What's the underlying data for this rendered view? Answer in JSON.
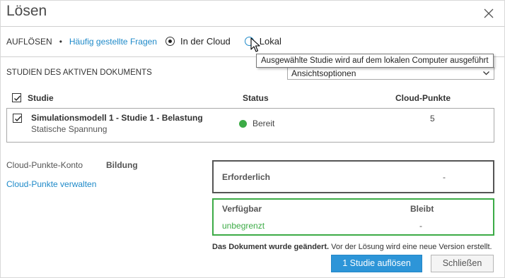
{
  "dialog": {
    "title": "Lösen"
  },
  "topbar": {
    "solve_label": "AUFLÖSEN",
    "separator": "•",
    "faq_link": "Häufig gestellte Fragen",
    "options": [
      {
        "label": "In der Cloud",
        "selected": true
      },
      {
        "label": "Lokal",
        "selected": false
      }
    ],
    "tooltip": "Ausgewählte Studie wird auf dem lokalen Computer ausgeführt"
  },
  "studies": {
    "section_label": "STUDIEN DES AKTIVEN DOKUMENTS",
    "view_options": "Ansichtsoptionen",
    "headers": {
      "study": "Studie",
      "status": "Status",
      "points": "Cloud-Punkte"
    },
    "rows": [
      {
        "name": "Simulationsmodell 1 - Studie 1 - Belastung",
        "type": "Statische Spannung",
        "status": "Bereit",
        "points": "5",
        "checked": true
      }
    ]
  },
  "account": {
    "label": "Cloud-Punkte-Konto",
    "value": "Bildung",
    "manage_link": "Cloud-Punkte verwalten"
  },
  "required": {
    "label": "Erforderlich",
    "value": "-"
  },
  "available": {
    "available_header": "Verfügbar",
    "remaining_header": "Bleibt",
    "available_value": "unbegrenzt",
    "remaining_value": "-"
  },
  "notice": {
    "bold": "Das Dokument wurde geändert.",
    "text": " Vor der Lösung wird eine neue Version erstellt."
  },
  "buttons": {
    "solve": "1 Studie auflösen",
    "close": "Schließen"
  },
  "colors": {
    "accent": "#2d95d8",
    "link": "#1f8ac9",
    "ready": "#3cab46"
  },
  "icons": [
    "close-icon",
    "radio-selected-icon",
    "radio-empty-icon",
    "mouse-cursor-icon",
    "chevron-down-icon",
    "checkbox-checked-icon",
    "status-ready-icon"
  ]
}
